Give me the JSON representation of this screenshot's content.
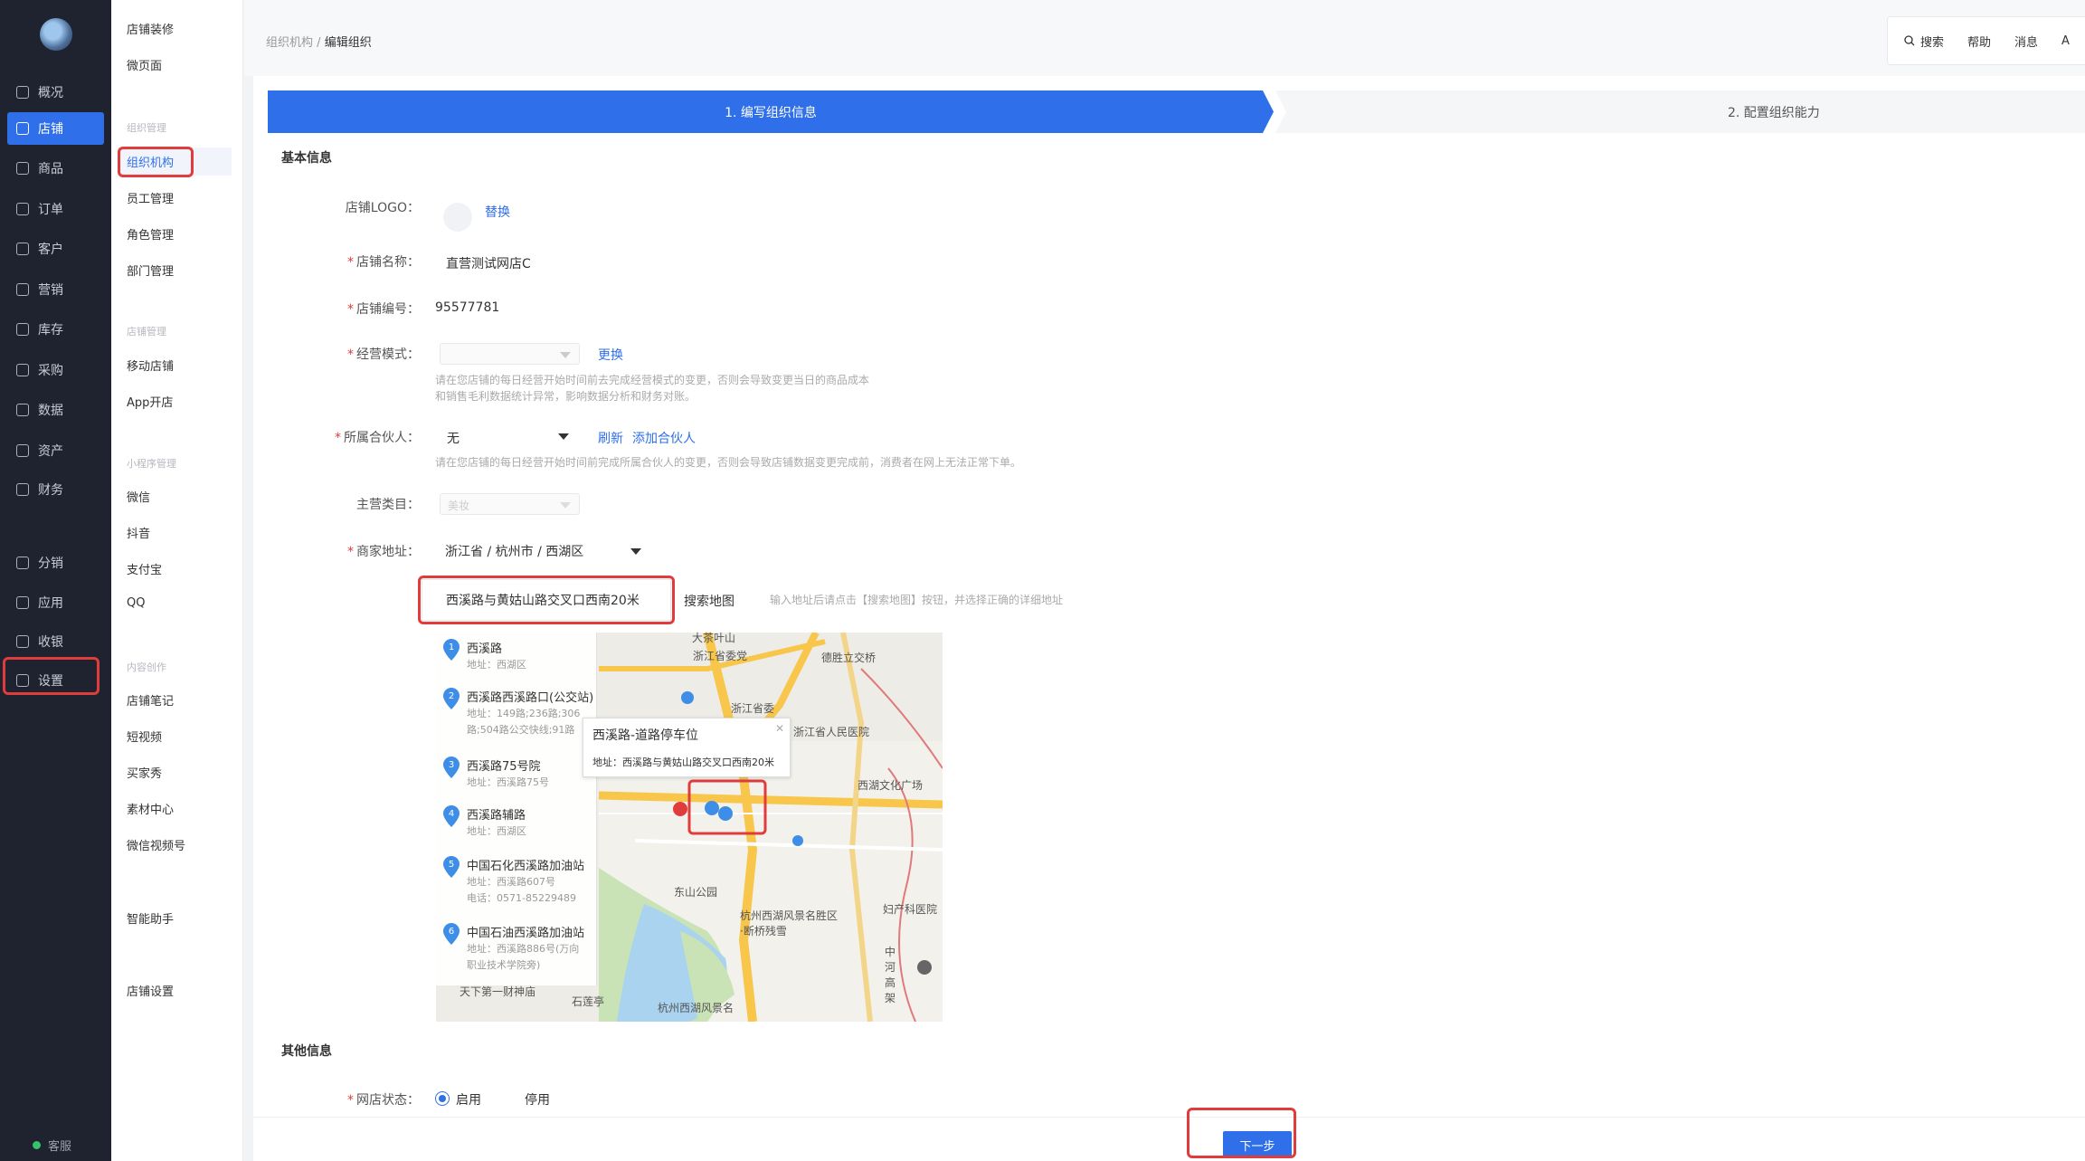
{
  "nav": {
    "items": [
      {
        "label": "概况",
        "icon": "overview-icon"
      },
      {
        "label": "店铺",
        "icon": "store-icon",
        "active": true
      },
      {
        "label": "商品",
        "icon": "goods-icon"
      },
      {
        "label": "订单",
        "icon": "order-icon"
      },
      {
        "label": "客户",
        "icon": "customer-icon"
      },
      {
        "label": "营销",
        "icon": "marketing-icon"
      },
      {
        "label": "库存",
        "icon": "inventory-icon"
      },
      {
        "label": "采购",
        "icon": "purchase-icon"
      },
      {
        "label": "数据",
        "icon": "data-icon"
      },
      {
        "label": "资产",
        "icon": "asset-icon"
      },
      {
        "label": "财务",
        "icon": "finance-icon"
      },
      {
        "label": "分销",
        "icon": "distribution-icon"
      },
      {
        "label": "应用",
        "icon": "apps-icon"
      },
      {
        "label": "收银",
        "icon": "cashier-icon"
      },
      {
        "label": "设置",
        "icon": "settings-icon"
      }
    ],
    "service": "客服",
    "accent": "#2f6fe9"
  },
  "sub": {
    "top_items": [
      "店铺装修",
      "微页面"
    ],
    "groups": [
      {
        "title": "组织管理",
        "items": [
          "组织机构",
          "员工管理",
          "角色管理",
          "部门管理"
        ]
      },
      {
        "title": "店铺管理",
        "items": [
          "移动店铺",
          "App开店"
        ]
      },
      {
        "title": "小程序管理",
        "items": [
          "微信",
          "抖音",
          "支付宝",
          "QQ"
        ]
      },
      {
        "title": "内容创作",
        "items": [
          "店铺笔记",
          "短视频",
          "买家秀",
          "素材中心",
          "微信视频号"
        ]
      }
    ],
    "extra": [
      "智能助手",
      "店铺设置"
    ]
  },
  "breadcrumb": {
    "parent": "组织机构",
    "sep": "/",
    "current": "编辑组织"
  },
  "toolbar": {
    "search": "搜索",
    "help": "帮助",
    "message": "消息",
    "more": "A"
  },
  "steps": {
    "step1": "1. 编写组织信息",
    "step2": "2. 配置组织能力"
  },
  "form": {
    "basic_title": "基本信息",
    "logo_label": "店铺LOGO：",
    "logo_action": "替换",
    "name_label": "店铺名称：",
    "name_value": "直营测试网店C",
    "code_label": "店铺编号：",
    "code_value": "95577781",
    "mode_label": "经营模式：",
    "mode_value": "",
    "mode_action": "更换",
    "mode_hint1": "请在您店铺的每日经营开始时间前去完成经营模式的变更，否则会导致变更当日的商品成本",
    "mode_hint2": "和销售毛利数据统计异常，影响数据分析和财务对账。",
    "partner_label": "所属合伙人：",
    "partner_value": "无",
    "partner_refresh": "刷新",
    "partner_add": "添加合伙人",
    "partner_hint": "请在您店铺的每日经营开始时间前完成所属合伙人的变更，否则会导致店铺数据变更完成前，消费者在网上无法正常下单。",
    "category_label": "主营类目：",
    "category_value": "美妆",
    "address_label": "商家地址：",
    "address_region": "浙江省 / 杭州市 / 西湖区",
    "address_detail": "西溪路与黄姑山路交叉口西南20米",
    "search_map": "搜索地图",
    "address_hint": "输入地址后请点击【搜索地图】按钮，并选择正确的详细地址",
    "other_title": "其他信息",
    "status_label": "网店状态：",
    "status_on": "启用",
    "status_off": "停用",
    "next": "下一步"
  },
  "map": {
    "results": [
      {
        "n": "1",
        "name": "西溪路",
        "sub": [
          "地址：西湖区"
        ]
      },
      {
        "n": "2",
        "name": "西溪路西溪路口(公交站)",
        "sub": [
          "地址：149路;236路;306",
          "路;504路公交快线;91路"
        ]
      },
      {
        "n": "3",
        "name": "西溪路75号院",
        "sub": [
          "地址：西溪路75号"
        ]
      },
      {
        "n": "4",
        "name": "西溪路辅路",
        "sub": [
          "地址：西湖区"
        ]
      },
      {
        "n": "5",
        "name": "中国石化西溪路加油站",
        "sub": [
          "地址：西溪路607号",
          "电话：0571-85229489"
        ]
      },
      {
        "n": "6",
        "name": "中国石油西溪路加油站",
        "sub": [
          "地址：西溪路886号(万向",
          "职业技术学院旁)"
        ]
      }
    ],
    "popup_title": "西溪路-道路停车位",
    "popup_address": "地址：西溪路与黄姑山路交叉口西南20米",
    "labels": [
      "大茶叶山",
      "德胜立交桥",
      "浙江省委党",
      "浙江省委",
      "浙江省人民医院",
      "西湖文化广场",
      "东山公园",
      "杭州西湖风景名胜区·断桥残雪",
      "妇产科医院",
      "天下第一财神庙",
      "石莲亭",
      "杭州西湖风景名",
      "中河高架"
    ]
  }
}
